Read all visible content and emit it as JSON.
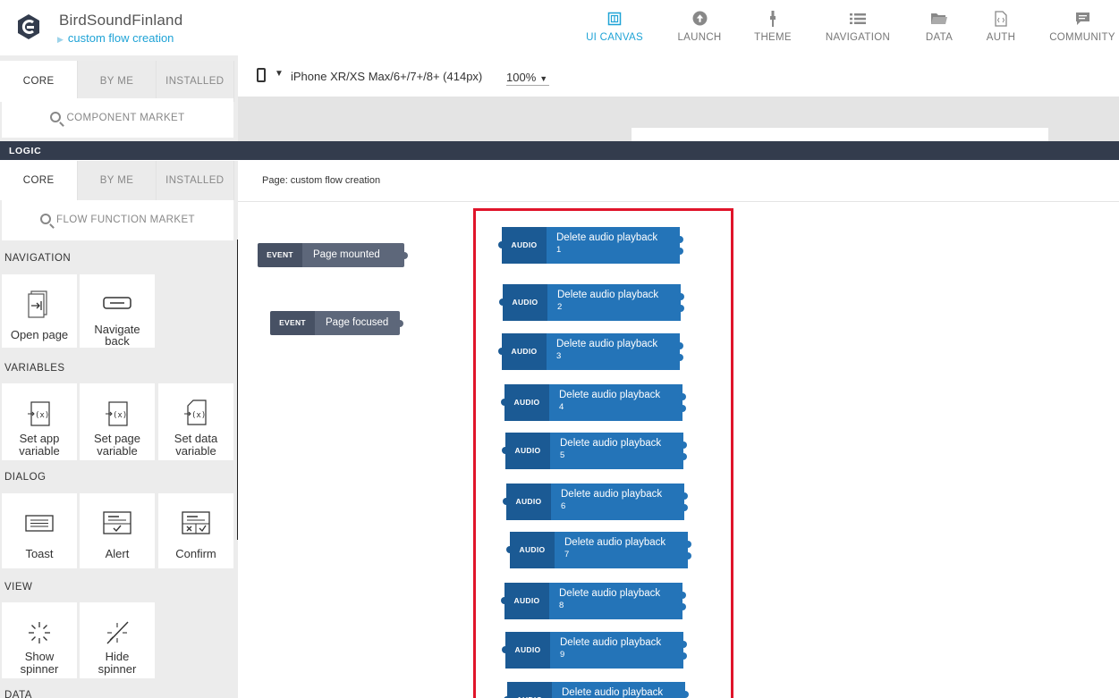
{
  "header": {
    "app_name": "BirdSoundFinland",
    "page_name": "custom flow creation",
    "nav": [
      {
        "label": "UI CANVAS",
        "icon": "ui-canvas-icon",
        "active": true
      },
      {
        "label": "LAUNCH",
        "icon": "launch-icon"
      },
      {
        "label": "THEME",
        "icon": "theme-brush-icon"
      },
      {
        "label": "NAVIGATION",
        "icon": "navigation-list-icon"
      },
      {
        "label": "DATA",
        "icon": "data-folder-icon"
      },
      {
        "label": "AUTH",
        "icon": "auth-document-icon"
      },
      {
        "label": "COMMUNITY",
        "icon": "community-chat-icon"
      }
    ]
  },
  "ui_panel": {
    "tabs": [
      "CORE",
      "BY ME",
      "INSTALLED"
    ],
    "market": "COMPONENT MARKET"
  },
  "canvas_toolbar": {
    "device": "iPhone XR/XS Max/6+/7+/8+ (414px)",
    "zoom": "100%"
  },
  "logic_bar": {
    "label": "LOGIC"
  },
  "logic_panel": {
    "tabs": [
      "CORE",
      "BY ME",
      "INSTALLED"
    ],
    "market": "FLOW FUNCTION MARKET",
    "sections": {
      "navigation": "NAVIGATION",
      "variables": "VARIABLES",
      "dialog": "DIALOG",
      "view": "VIEW",
      "data": "DATA"
    },
    "cards": {
      "open_page": "Open page",
      "navigate_back_1": "Navigate",
      "navigate_back_2": "back",
      "set_app_var_1": "Set app",
      "set_app_var_2": "variable",
      "set_page_var_1": "Set page",
      "set_page_var_2": "variable",
      "set_data_var_1": "Set data",
      "set_data_var_2": "variable",
      "toast": "Toast",
      "alert": "Alert",
      "confirm": "Confirm",
      "show_spinner_1": "Show",
      "show_spinner_2": "spinner",
      "hide_spinner_1": "Hide",
      "hide_spinner_2": "spinner"
    }
  },
  "flow": {
    "page_label": "Page: custom flow creation",
    "events": [
      {
        "tag": "EVENT",
        "name": "Page mounted"
      },
      {
        "tag": "EVENT",
        "name": "Page focused"
      }
    ],
    "audio_blocks": [
      {
        "tag": "AUDIO",
        "name": "Delete audio playback",
        "num": "1"
      },
      {
        "tag": "AUDIO",
        "name": "Delete audio playback",
        "num": "2"
      },
      {
        "tag": "AUDIO",
        "name": "Delete audio playback",
        "num": "3"
      },
      {
        "tag": "AUDIO",
        "name": "Delete audio playback",
        "num": "4"
      },
      {
        "tag": "AUDIO",
        "name": "Delete audio playback",
        "num": "5"
      },
      {
        "tag": "AUDIO",
        "name": "Delete audio playback",
        "num": "6"
      },
      {
        "tag": "AUDIO",
        "name": "Delete audio playback",
        "num": "7"
      },
      {
        "tag": "AUDIO",
        "name": "Delete audio playback",
        "num": "8"
      },
      {
        "tag": "AUDIO",
        "name": "Delete audio playback",
        "num": "9"
      },
      {
        "tag": "AUDIO",
        "name": "Delete audio playback",
        "num": ""
      }
    ]
  },
  "colors": {
    "accent": "#1fa3d6",
    "logic_bar": "#333c4d",
    "audio_tag": "#1b5a94",
    "audio_body": "#2474b8",
    "event_tag": "#475164",
    "event_body": "#5d677a",
    "highlight": "#e0142a"
  }
}
